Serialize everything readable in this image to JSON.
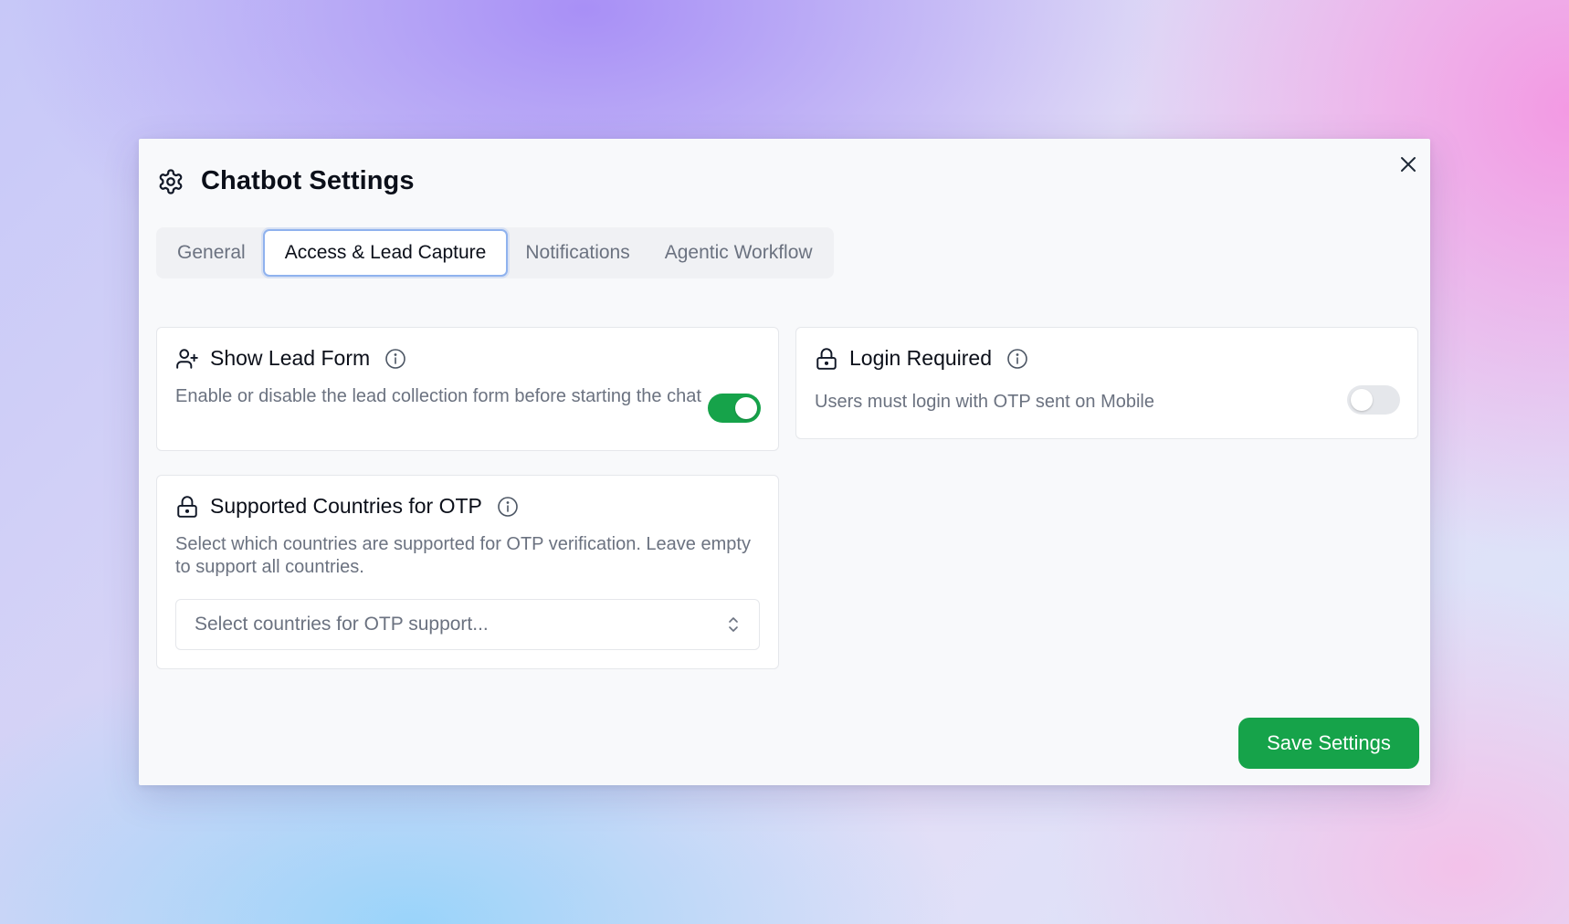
{
  "dialog": {
    "title": "Chatbot Settings",
    "close_icon": "close-icon",
    "header_icon": "gear-icon"
  },
  "tabs": [
    {
      "label": "General",
      "active": false
    },
    {
      "label": "Access & Lead Capture",
      "active": true
    },
    {
      "label": "Notifications",
      "active": false
    },
    {
      "label": "Agentic Workflow",
      "active": false
    }
  ],
  "lead_form": {
    "icon": "user-plus-icon",
    "title": "Show Lead Form",
    "description": "Enable or disable the lead collection form before starting the chat",
    "enabled": true
  },
  "login_required": {
    "icon": "lock-icon",
    "title": "Login Required",
    "description": "Users must login with OTP sent on Mobile",
    "enabled": false
  },
  "otp_countries": {
    "icon": "lock-icon",
    "title": "Supported Countries for OTP",
    "description": "Select which countries are supported for OTP verification. Leave empty to support all countries.",
    "select_placeholder": "Select countries for OTP support..."
  },
  "footer": {
    "save_label": "Save Settings"
  },
  "colors": {
    "accent_green": "#16a34a",
    "active_tab_border": "#8fb2ee",
    "muted_text": "#6b7280"
  }
}
